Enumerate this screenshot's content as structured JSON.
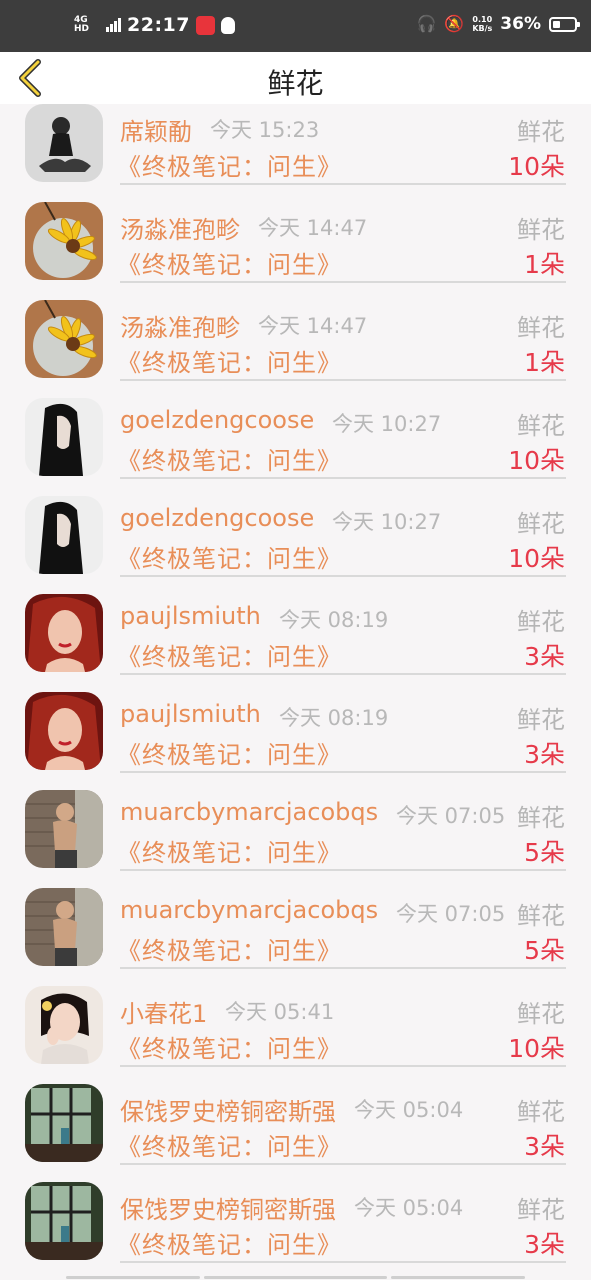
{
  "status_bar": {
    "network": "4G HD",
    "time": "22:17",
    "speed_value": "0.10",
    "speed_unit": "KB/s",
    "battery": "36%",
    "battery_level": 0.36
  },
  "header": {
    "title": "鲜花"
  },
  "gift_label": "鲜花",
  "book_title": "《终极笔记：问生》",
  "rows": [
    {
      "name": "席颖勈",
      "time": "今天 15:23",
      "count": "10朵",
      "avatar": "girl-sitting-bw"
    },
    {
      "name": "汤淼准孢畛",
      "time": "今天 14:47",
      "count": "1朵",
      "avatar": "sunflower-plate"
    },
    {
      "name": "汤淼准孢畛",
      "time": "今天 14:47",
      "count": "1朵",
      "avatar": "sunflower-plate"
    },
    {
      "name": "goelzdengcoose",
      "time": "今天 10:27",
      "count": "10朵",
      "avatar": "girl-long-hair"
    },
    {
      "name": "goelzdengcoose",
      "time": "今天 10:27",
      "count": "10朵",
      "avatar": "girl-long-hair"
    },
    {
      "name": "paujlsmiuth",
      "time": "今天 08:19",
      "count": "3朵",
      "avatar": "red-hair-woman"
    },
    {
      "name": "paujlsmiuth",
      "time": "今天 08:19",
      "count": "3朵",
      "avatar": "red-hair-woman"
    },
    {
      "name": "muarcbymarcjacobqs",
      "time": "今天 07:05",
      "count": "5朵",
      "avatar": "man-brick-wall"
    },
    {
      "name": "muarcbymarcjacobqs",
      "time": "今天 07:05",
      "count": "5朵",
      "avatar": "man-brick-wall"
    },
    {
      "name": "小春花1",
      "time": "今天 05:41",
      "count": "10朵",
      "avatar": "girl-flower-hair"
    },
    {
      "name": "保饯罗史榜铜密斯强",
      "time": "今天 05:04",
      "count": "3朵",
      "avatar": "window-scene"
    },
    {
      "name": "保饯罗史榜铜密斯强",
      "time": "今天 05:04",
      "count": "3朵",
      "avatar": "window-scene"
    }
  ]
}
